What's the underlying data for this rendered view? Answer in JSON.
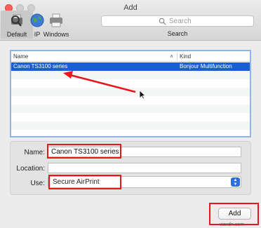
{
  "window": {
    "title": "Add"
  },
  "toolbar": {
    "items": [
      {
        "label": "Default",
        "icon": "default-printers-icon"
      },
      {
        "label": "IP",
        "icon": "globe-icon"
      },
      {
        "label": "Windows",
        "icon": "windows-printer-icon"
      }
    ],
    "search": {
      "placeholder": "Search",
      "label": "Search"
    }
  },
  "list": {
    "columns": {
      "name": "Name",
      "kind": "Kind"
    },
    "rows": [
      {
        "name": "Canon TS3100 series",
        "kind": "Bonjour Multifunction",
        "selected": true
      }
    ]
  },
  "form": {
    "name_label": "Name:",
    "name_value": "Canon TS3100 series",
    "location_label": "Location:",
    "location_value": "",
    "use_label": "Use:",
    "use_value": "Secure AirPrint"
  },
  "buttons": {
    "add_label": "Add"
  },
  "annotation_color": "#e8151b",
  "selection_color": "#1a5fd0",
  "watermark": "wsxdn.com"
}
